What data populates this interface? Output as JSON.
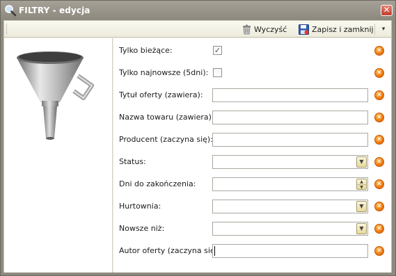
{
  "window": {
    "title": "FILTRY - edycja",
    "close_glyph": "✕"
  },
  "toolbar": {
    "clear_label": "Wyczyść",
    "save_close_label": "Zapisz i zamknij",
    "more_glyph": "▾"
  },
  "icons": {
    "title": "magnifier-icon",
    "clear": "trash-icon",
    "save": "floppy-disk-icon",
    "panel": "funnel-icon",
    "field_clear": "clear-field-icon"
  },
  "form": {
    "fields": [
      {
        "label": "Tylko bieżące:",
        "type": "checkbox",
        "checked": true
      },
      {
        "label": "Tylko najnowsze (5dni):",
        "type": "checkbox",
        "checked": false
      },
      {
        "label": "Tytuł oferty (zawiera):",
        "type": "text",
        "value": ""
      },
      {
        "label": "Nazwa towaru (zawiera):",
        "type": "text",
        "value": ""
      },
      {
        "label": "Producent (zaczyna się):",
        "type": "text",
        "value": ""
      },
      {
        "label": "Status:",
        "type": "combo",
        "value": ""
      },
      {
        "label": "Dni do zakończenia:",
        "type": "spin",
        "value": ""
      },
      {
        "label": "Hurtownia:",
        "type": "combo",
        "value": ""
      },
      {
        "label": "Nowsze niż:",
        "type": "combo",
        "value": ""
      },
      {
        "label": "Autor oferty (zaczyna się):",
        "type": "text",
        "value": ""
      }
    ]
  },
  "colors": {
    "titlebar": "#8c887d",
    "clear_icon": "#f0780d",
    "combo_button": "#e6d99a"
  }
}
